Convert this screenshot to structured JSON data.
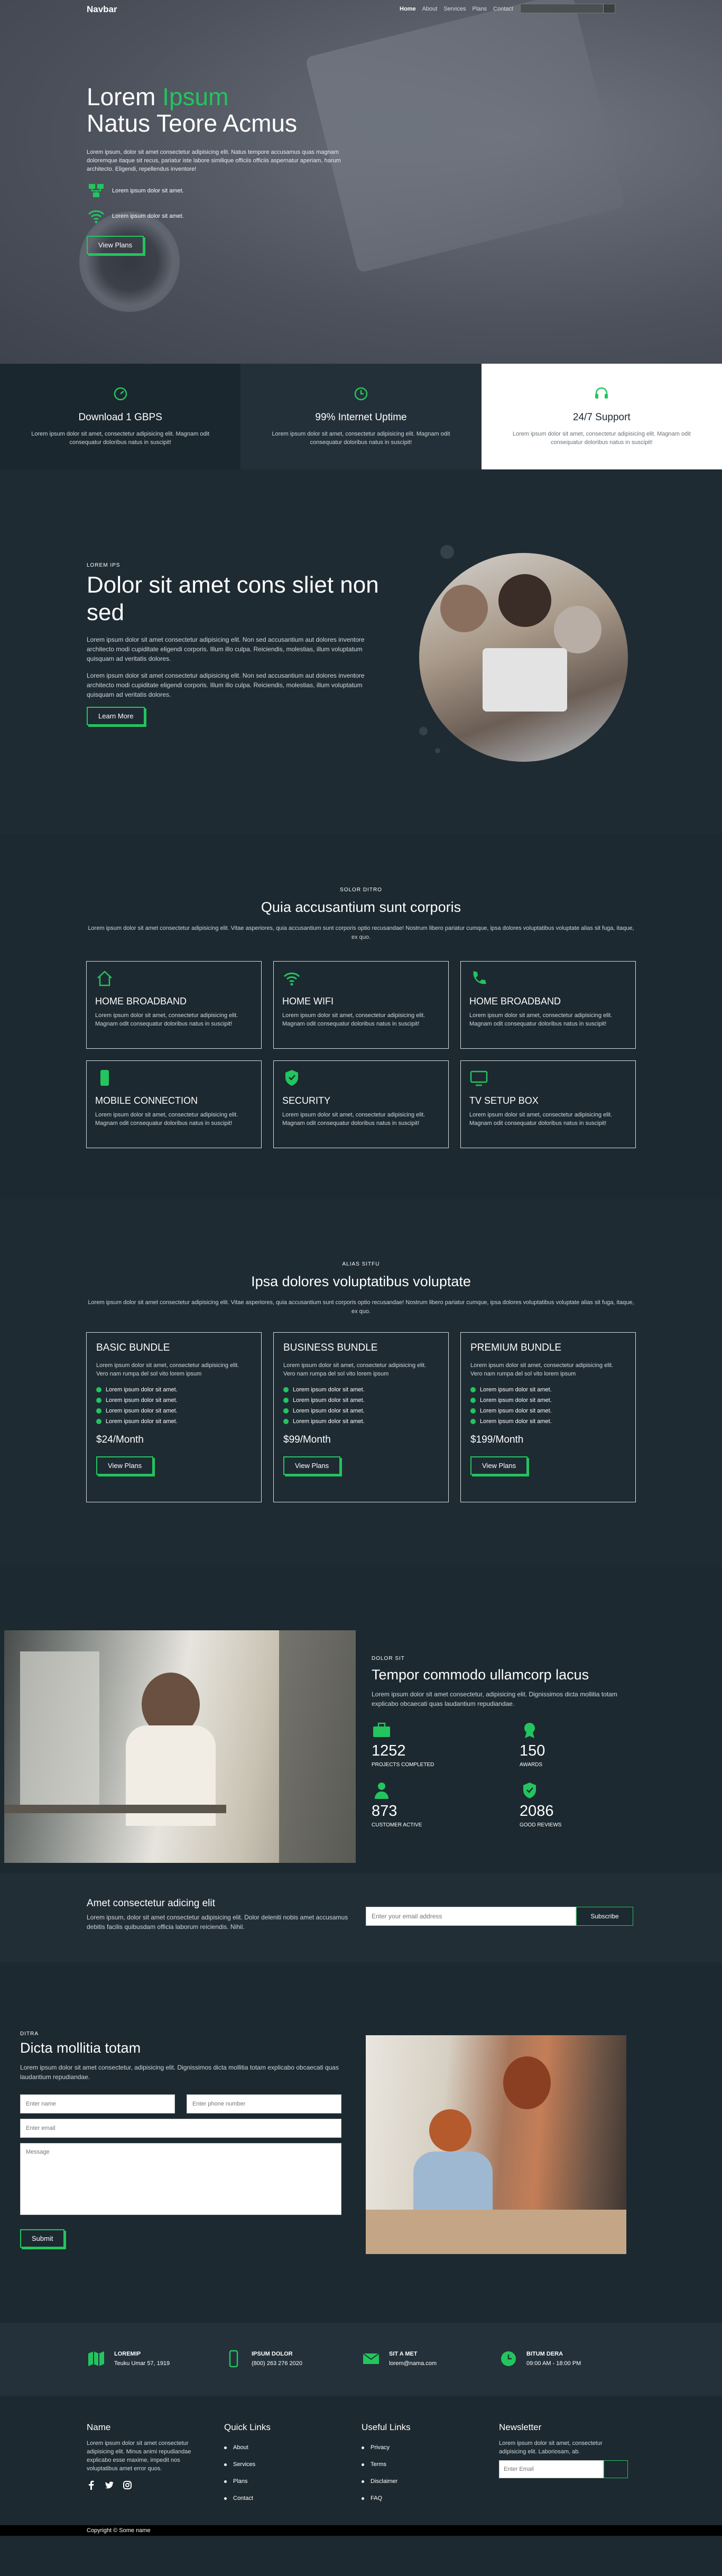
{
  "navbar": {
    "brand": "Navbar",
    "links": [
      "Home",
      "About",
      "Services",
      "Plans",
      "Contact"
    ]
  },
  "hero": {
    "title_line1_a": "Lorem ",
    "title_line1_b": "Ipsum",
    "title_line2": "Natus Teore Acmus",
    "description": "Lorem ipsum, dolor sit amet consectetur adipisicing elit. Natus tempore accusamus quas magnam doloremque itaque sit recus, pariatur iste labore similique officiis officiis aspernatur aperiam, harum architecto. Eligendi, repellendus inventore!",
    "features": [
      "Lorem ipsum dolor sit amet.",
      "Lorem ipsum dolor sit amet."
    ],
    "button": "View Plans"
  },
  "strip": [
    {
      "title": "Download 1 GBPS",
      "text": "Lorem ipsum dolor sit amet, consectetur adipisicing elit. Magnam odit consequatur doloribus natus in suscipit!"
    },
    {
      "title": "99% Internet Uptime",
      "text": "Lorem ipsum dolor sit amet, consectetur adipisicing elit. Magnam odit consequatur doloribus natus in suscipit!"
    },
    {
      "title": "24/7 Support",
      "text": "Lorem ipsum dolor sit amet, consectetur adipisicing elit. Magnam odit consequatur doloribus natus in suscipit!"
    }
  ],
  "about": {
    "tag": "LOREM IPS",
    "title": "Dolor sit amet cons sliet non sed",
    "para1": "Lorem ipsum dolor sit amet consectetur adipisicing elit. Non sed accusantium aut dolores inventore architecto modi cupiditate eligendi corporis. Illum illo culpa. Reiciendis, molestias, illum voluptatum quisquam ad veritatis dolores.",
    "para2": "Lorem ipsum dolor sit amet consectetur adipisicing elit. Non sed accusantium aut dolores inventore architecto modi cupiditate eligendi corporis. Illum illo culpa. Reiciendis, molestias, illum voluptatum quisquam ad veritatis dolores.",
    "button": "Learn More"
  },
  "services": {
    "tag": "SOLOR DITRO",
    "title": "Quia accusantium sunt corporis",
    "description": "Lorem ipsum dolor sit amet consectetur adipisicing elit. Vitae asperiores, quia accusantium sunt corporis optio recusandae! Nostrum libero pariatur cumque, ipsa dolores voluptatibus voluptate alias sit fuga, itaque, ex quo.",
    "cards": [
      {
        "icon": "home-icon",
        "title": "HOME BROADBAND",
        "text": "Lorem ipsum dolor sit amet, consectetur adipisicing elit. Magnam odit consequatur doloribus natus in suscipit!"
      },
      {
        "icon": "wifi-icon",
        "title": "HOME WIFI",
        "text": "Lorem ipsum dolor sit amet, consectetur adipisicing elit. Magnam odit consequatur doloribus natus in suscipit!"
      },
      {
        "icon": "phone-icon",
        "title": "HOME BROADBAND",
        "text": "Lorem ipsum dolor sit amet, consectetur adipisicing elit. Magnam odit consequatur doloribus natus in suscipit!"
      },
      {
        "icon": "mobile-icon",
        "title": "MOBILE CONNECTION",
        "text": "Lorem ipsum dolor sit amet, consectetur adipisicing elit. Magnam odit consequatur doloribus natus in suscipit!"
      },
      {
        "icon": "shield-icon",
        "title": "SECURITY",
        "text": "Lorem ipsum dolor sit amet, consectetur adipisicing elit. Magnam odit consequatur doloribus natus in suscipit!"
      },
      {
        "icon": "tv-icon",
        "title": "TV SETUP BOX",
        "text": "Lorem ipsum dolor sit amet, consectetur adipisicing elit. Magnam odit consequatur doloribus natus in suscipit!"
      }
    ]
  },
  "pricing": {
    "tag": "ALIAS SITFU",
    "title": "Ipsa dolores voluptatibus voluptate",
    "description": "Lorem ipsum dolor sit amet consectetur adipisicing elit. Vitae asperiores, quia accusantium sunt corporis optio recusandae! Nostrum libero pariatur cumque, ipsa dolores voluptatibus voluptate alias sit fuga, itaque, ex quo.",
    "plans": [
      {
        "title": "BASIC BUNDLE",
        "text": "Lorem ipsum dolor sit amet, consectetur adipisicing elit. Vero nam rumpa del sol vito lorem ipsum",
        "items": [
          "Lorem ipsum dolor sit amet.",
          "Lorem ipsum dolor sit amet.",
          "Lorem ipsum dolor sit amet.",
          "Lorem ipsum dolor sit amet."
        ],
        "price": "$24/Month",
        "button": "View Plans"
      },
      {
        "title": "BUSINESS BUNDLE",
        "text": "Lorem ipsum dolor sit amet, consectetur adipisicing elit. Vero nam rumpa del sol vito lorem ipsum",
        "items": [
          "Lorem ipsum dolor sit amet.",
          "Lorem ipsum dolor sit amet.",
          "Lorem ipsum dolor sit amet.",
          "Lorem ipsum dolor sit amet."
        ],
        "price": "$99/Month",
        "button": "View Plans"
      },
      {
        "title": "PREMIUM BUNDLE",
        "text": "Lorem ipsum dolor sit amet, consectetur adipisicing elit. Vero nam rumpa del sol vito lorem ipsum",
        "items": [
          "Lorem ipsum dolor sit amet.",
          "Lorem ipsum dolor sit amet.",
          "Lorem ipsum dolor sit amet.",
          "Lorem ipsum dolor sit amet."
        ],
        "price": "$199/Month",
        "button": "View Plans"
      }
    ]
  },
  "stats": {
    "tag": "DOLOR SIT",
    "title": "Tempor commodo ullamcorp lacus",
    "text": "Lorem ipsum dolor sit amet consectetur, adipisicing elit. Dignissimos dicta mollitia totam explicabo obcaecati quas laudantium repudiandae.",
    "items": [
      {
        "icon": "briefcase-icon",
        "num": "1252",
        "label": "PROJECTS COMPLETED"
      },
      {
        "icon": "award-icon",
        "num": "150",
        "label": "AWARDS"
      },
      {
        "icon": "user-icon",
        "num": "873",
        "label": "CUSTOMER ACTIVE"
      },
      {
        "icon": "shield-check-icon",
        "num": "2086",
        "label": "GOOD REVIEWS"
      }
    ]
  },
  "subscribe": {
    "title": "Amet consectetur adicing elit",
    "text": "Lorem ipsum, dolor sit amet consectetur adipisicing elit. Dolor deleniti nobis amet accusamus debitis facilis quibusdam officia laborum reiciendis. Nihil.",
    "placeholder": "Enter your email address",
    "button": "Subscribe"
  },
  "contact": {
    "tag": "DITRA",
    "title": "Dicta mollitia totam",
    "text": "Lorem ipsum dolor sit amet consectetur, adipisicing elit. Dignissimos dicta mollitia totam explicabo obcaecati quas laudantium repudiandae.",
    "name_placeholder": "Enter name",
    "phone_placeholder": "Enter phone number",
    "email_placeholder": "Enter email",
    "message_placeholder": "Message",
    "button": "Submit"
  },
  "info": [
    {
      "icon": "map-icon",
      "title": "LOREMIP",
      "value": "Teuku Umar 57, 1919"
    },
    {
      "icon": "mobile-icon",
      "title": "IPSUM DOLOR",
      "value": "(800) 263 276 2020"
    },
    {
      "icon": "envelope-icon",
      "title": "SIT A MET",
      "value": "lorem@nama.com"
    },
    {
      "icon": "clock-icon",
      "title": "BITUM DERA",
      "value": "09:00 AM - 18:00 PM"
    }
  ],
  "footer": {
    "name_title": "Name",
    "name_text": "Lorem ipsum dolor sit amet consectetur adipisicing elit. Minus animi repudiandae explicabo esse maxime, impedit nos voluptatibus amet error quos.",
    "quick_title": "Quick Links",
    "quick_links": [
      "About",
      "Services",
      "Plans",
      "Contact"
    ],
    "useful_title": "Useful Links",
    "useful_links": [
      "Privacy",
      "Terms",
      "Disclaimer",
      "FAQ"
    ],
    "newsletter_title": "Newsletter",
    "newsletter_text": "Lorem ipsum dolor sit amet, consectetur adipisicing elit. Laboriosam, ab.",
    "newsletter_placeholder": "Enter Email"
  },
  "copyright": "Copyright © Some name",
  "colors": {
    "accent": "#22c55e",
    "dark": "#1d2930",
    "light": "#ffffff"
  }
}
